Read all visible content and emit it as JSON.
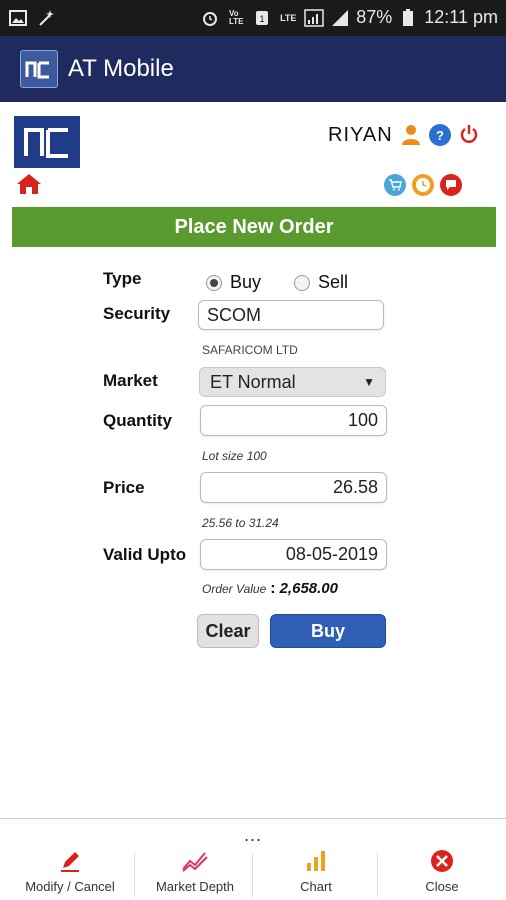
{
  "status_bar": {
    "battery": "87%",
    "time": "12:11 pm",
    "icons": [
      "image-icon",
      "wand-icon",
      "alarm-icon",
      "volte-icon",
      "sim1-icon",
      "lte-icon",
      "signal-icon",
      "battery-icon"
    ]
  },
  "app_bar": {
    "title": "AT Mobile"
  },
  "header": {
    "user": "RIYAN",
    "icons": [
      "user-icon",
      "help-icon",
      "power-icon"
    ],
    "row2_icons": [
      "cart-icon",
      "clock-icon",
      "chat-icon",
      "home-icon"
    ]
  },
  "banner": {
    "title": "Place New Order"
  },
  "form": {
    "type_label": "Type",
    "buy_label": "Buy",
    "sell_label": "Sell",
    "selected_type": "Buy",
    "security_label": "Security",
    "security_value": "SCOM",
    "security_name": "SAFARICOM LTD",
    "market_label": "Market",
    "market_value": "ET Normal",
    "quantity_label": "Quantity",
    "quantity_value": "100",
    "lot_size": "Lot size 100",
    "price_label": "Price",
    "price_value": "26.58",
    "price_range": "25.56 to 31.24",
    "valid_label": "Valid Upto",
    "valid_value": "08-05-2019",
    "order_value_label": "Order Value",
    "order_value_sep": ":",
    "order_value": "2,658.00"
  },
  "buttons": {
    "clear": "Clear",
    "buy": "Buy"
  },
  "bottom_nav": {
    "more": "...",
    "tabs": [
      {
        "label": "Modify / Cancel",
        "icon": "pencil-icon"
      },
      {
        "label": "Market Depth",
        "icon": "depth-chart-icon"
      },
      {
        "label": "Chart",
        "icon": "bar-chart-icon"
      },
      {
        "label": "Close",
        "icon": "close-icon"
      }
    ]
  },
  "colors": {
    "app_bar": "#1f2b5e",
    "banner": "#5a9a2f",
    "primary_button": "#2f5eb5",
    "accent_red": "#d9241b",
    "accent_orange": "#f0a020"
  }
}
